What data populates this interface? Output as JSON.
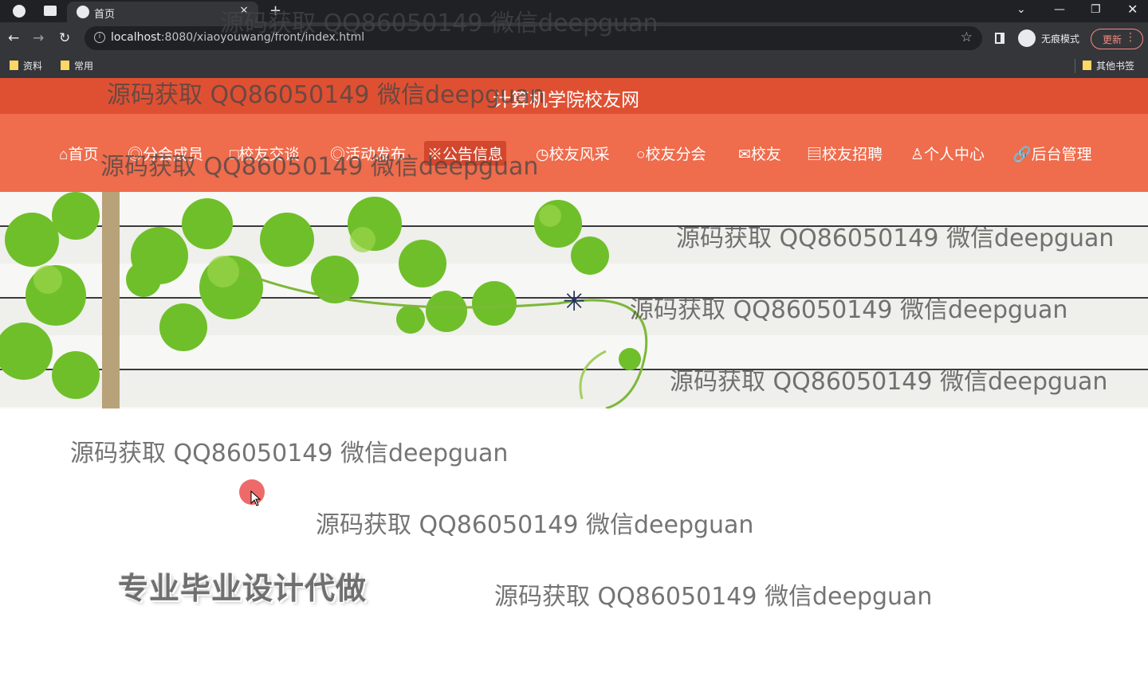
{
  "browser": {
    "tab_title": "首页",
    "tab_close": "×",
    "new_tab": "+",
    "url_host": "localhost",
    "url_rest": ":8080/xiaoyouwang/front/index.html",
    "incognito_label": "无痕模式",
    "update_label": "更新",
    "bookmarks": [
      "资料",
      "常用"
    ],
    "other_bookmarks": "其他书签",
    "accent_update": "#f28b82"
  },
  "site": {
    "title": "计算机学院校友网",
    "header_color": "#df5032",
    "nav_color": "#ef6c4c",
    "nav": [
      {
        "icon": "home-icon",
        "glyph": "⌂",
        "label": "首页"
      },
      {
        "icon": "users-icon",
        "glyph": "◎",
        "label": "分会成员"
      },
      {
        "icon": "chat-icon",
        "glyph": "□",
        "label": "校友交谈"
      },
      {
        "icon": "activity-icon",
        "glyph": "◎",
        "label": "活动发布"
      },
      {
        "icon": "notice-icon",
        "glyph": "※",
        "label": "公告信息",
        "active": true
      },
      {
        "icon": "style-icon",
        "glyph": "◷",
        "label": "校友风采"
      },
      {
        "icon": "branch-icon",
        "glyph": "○",
        "label": "校友分会"
      },
      {
        "icon": "mail-icon",
        "glyph": "✉",
        "label": "校友"
      },
      {
        "icon": "recruit-icon",
        "glyph": "▤",
        "label": "校友招聘"
      },
      {
        "icon": "user-icon",
        "glyph": "♙",
        "label": "个人中心"
      },
      {
        "icon": "link-icon",
        "glyph": "🔗",
        "label": "后台管理"
      }
    ],
    "slogan": "专业毕业设计代做",
    "watermark": "源码获取 QQ86050149 微信deepguan"
  }
}
